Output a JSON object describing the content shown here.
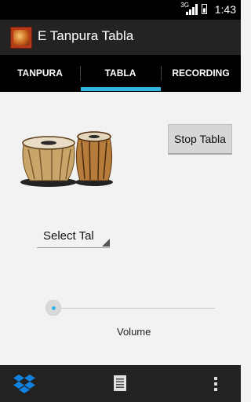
{
  "status_bar": {
    "network": "3G",
    "battery_level": "12",
    "time": "1:43"
  },
  "app": {
    "title": "E Tanpura Tabla"
  },
  "tabs": [
    {
      "label": "TANPURA",
      "selected": false
    },
    {
      "label": "TABLA",
      "selected": true
    },
    {
      "label": "RECORDING",
      "selected": false
    }
  ],
  "tabla": {
    "stop_button_label": "Stop Tabla",
    "tal_spinner_value": "Select Tal",
    "volume_label": "Volume",
    "volume_level": 0
  },
  "colors": {
    "accent": "#33b5e5",
    "action_bar": "#232323",
    "tab_bar": "#000000",
    "dropbox": "#1081de"
  },
  "bottom_bar": {
    "icons": [
      "dropbox-icon",
      "document-icon",
      "overflow-menu-icon"
    ]
  }
}
